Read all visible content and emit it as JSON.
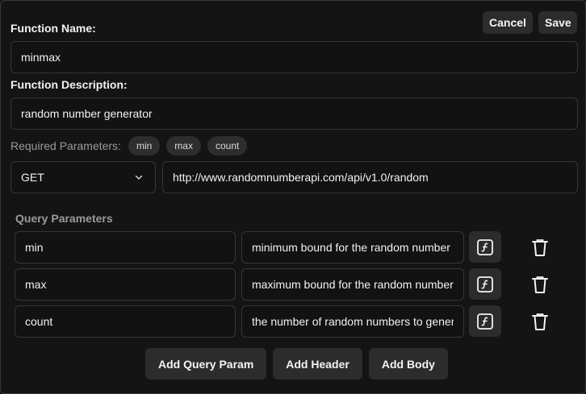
{
  "actions": {
    "cancel_label": "Cancel",
    "save_label": "Save"
  },
  "function_name": {
    "label": "Function Name:",
    "value": "minmax"
  },
  "function_description": {
    "label": "Function Description:",
    "value": "random number generator"
  },
  "required_parameters": {
    "label": "Required Parameters:",
    "items": [
      "min",
      "max",
      "count"
    ]
  },
  "request": {
    "method": "GET",
    "url": "http://www.randomnumberapi.com/api/v1.0/random"
  },
  "query_parameters": {
    "title": "Query Parameters",
    "rows": [
      {
        "name": "min",
        "description": "minimum bound for the random number"
      },
      {
        "name": "max",
        "description": "maximum bound for the random number"
      },
      {
        "name": "count",
        "description": "the number of random numbers to generate"
      }
    ]
  },
  "bottom_actions": {
    "add_query_param": "Add Query Param",
    "add_header": "Add Header",
    "add_body": "Add Body"
  },
  "colors": {
    "background": "#141414",
    "field_border": "#363636",
    "button_bg": "#2c2c2c",
    "muted_text": "#9a9a9a"
  }
}
